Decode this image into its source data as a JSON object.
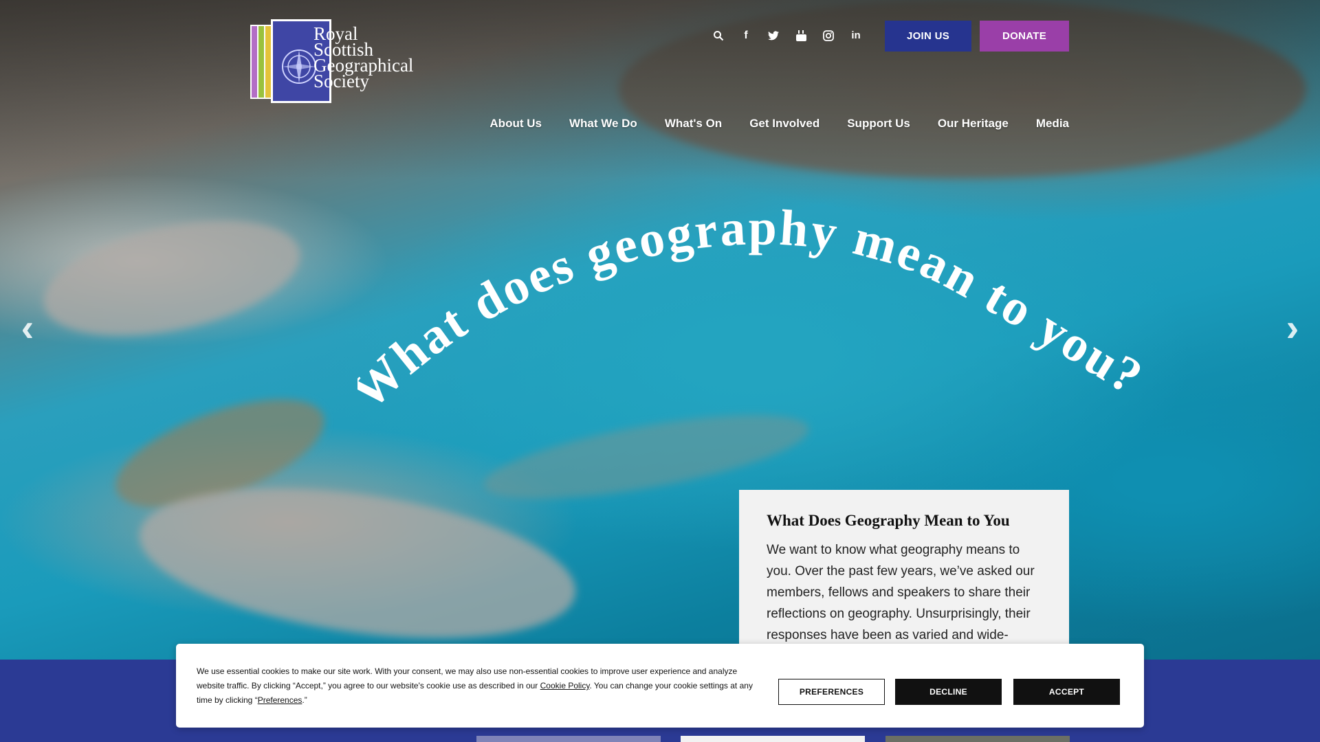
{
  "logo": {
    "lines": [
      "Royal",
      "Scottish",
      "Geographical",
      "Society"
    ]
  },
  "utility": {
    "icons": [
      {
        "name": "search-icon",
        "glyph": "⚲"
      },
      {
        "name": "facebook-icon",
        "glyph": "f"
      },
      {
        "name": "twitter-icon",
        "glyph": "🐦"
      },
      {
        "name": "youtube-icon",
        "glyph": "▶"
      },
      {
        "name": "instagram-icon",
        "glyph": "◎"
      },
      {
        "name": "linkedin-icon",
        "glyph": "in"
      }
    ],
    "join_label": "JOIN US",
    "donate_label": "DONATE"
  },
  "nav": {
    "items": [
      "About Us",
      "What We Do",
      "What's On",
      "Get Involved",
      "Support Us",
      "Our Heritage",
      "Media"
    ]
  },
  "hero": {
    "headline": "What does geography mean to you?",
    "prev_glyph": "‹",
    "next_glyph": "›"
  },
  "card": {
    "title": "What Does Geography Mean to You",
    "body": "We want to know what geography means to you. Over the past few years, we’ve asked our members, fellows and speakers to share their reflections on geography. Unsurprisingly, their responses have been as varied and wide-"
  },
  "cookie": {
    "text_before": "We use essential cookies to make our site work. With your consent, we may also use non-essential cookies to improve user experience and analyze website traffic. By clicking “Accept,” you agree to our website's cookie use as described in our ",
    "policy_link": "Cookie Policy",
    "text_middle": ". You can change your cookie settings at any time by clicking “",
    "preferences_link": "Preferences",
    "text_after": ".”",
    "preferences_button": "PREFERENCES",
    "decline_button": "DECLINE",
    "accept_button": "ACCEPT"
  },
  "colors": {
    "join": "#26348f",
    "donate": "#9a3fa8",
    "footer_band": "#2b3a94"
  }
}
